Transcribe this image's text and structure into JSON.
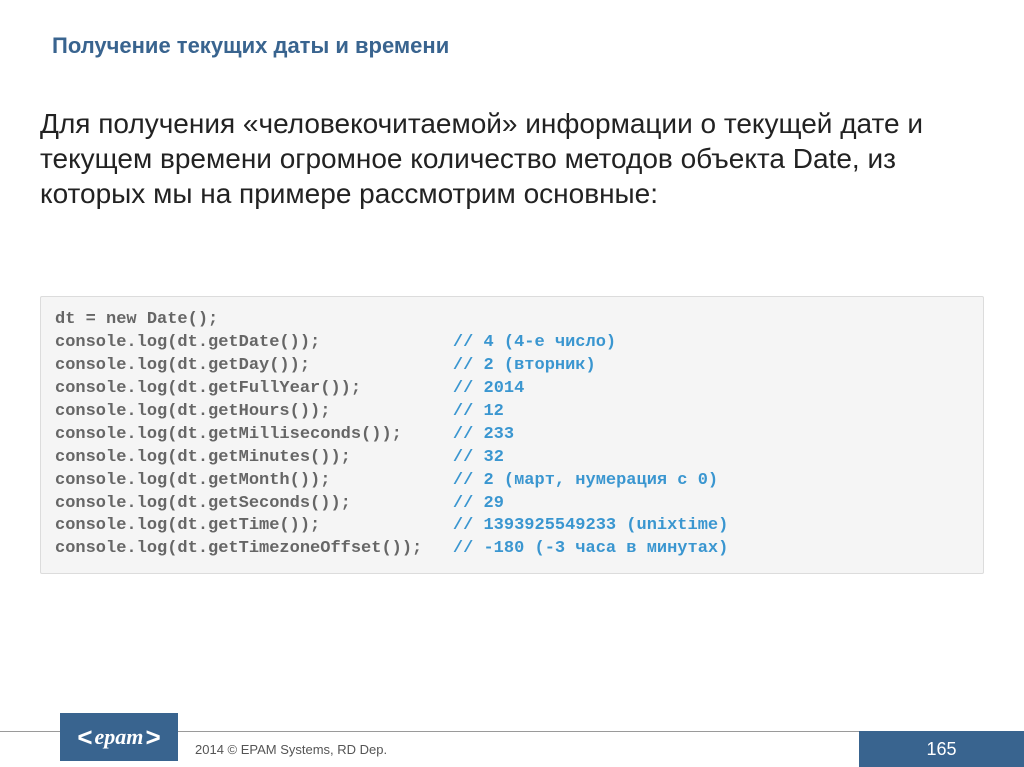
{
  "heading": "Получение текущих даты и времени",
  "body": "Для получения «человекочитаемой» информации о текущей дате и текущем времени огромное количество методов объекта Date, из которых мы на примере рассмотрим основные:",
  "code": {
    "lines": [
      {
        "text": "dt = new Date();",
        "pad": "",
        "comment": ""
      },
      {
        "text": "console.log(dt.getDate());",
        "pad": "             ",
        "comment": "// 4 (4-е число)"
      },
      {
        "text": "console.log(dt.getDay());",
        "pad": "              ",
        "comment": "// 2 (вторник)"
      },
      {
        "text": "console.log(dt.getFullYear());",
        "pad": "         ",
        "comment": "// 2014"
      },
      {
        "text": "console.log(dt.getHours());",
        "pad": "            ",
        "comment": "// 12"
      },
      {
        "text": "console.log(dt.getMilliseconds());",
        "pad": "     ",
        "comment": "// 233"
      },
      {
        "text": "console.log(dt.getMinutes());",
        "pad": "          ",
        "comment": "// 32"
      },
      {
        "text": "console.log(dt.getMonth());",
        "pad": "            ",
        "comment": "// 2 (март, нумерация с 0)"
      },
      {
        "text": "console.log(dt.getSeconds());",
        "pad": "          ",
        "comment": "// 29"
      },
      {
        "text": "console.log(dt.getTime());",
        "pad": "             ",
        "comment": "// 1393925549233 (unixtime)"
      },
      {
        "text": "console.log(dt.getTimezoneOffset());",
        "pad": "   ",
        "comment": "// -180 (-3 часа в минутах)"
      }
    ]
  },
  "footer": {
    "copyright": "2014 © EPAM Systems, RD Dep.",
    "page": "165",
    "logo": {
      "left": "<",
      "word": "epam",
      "right": ">"
    }
  }
}
